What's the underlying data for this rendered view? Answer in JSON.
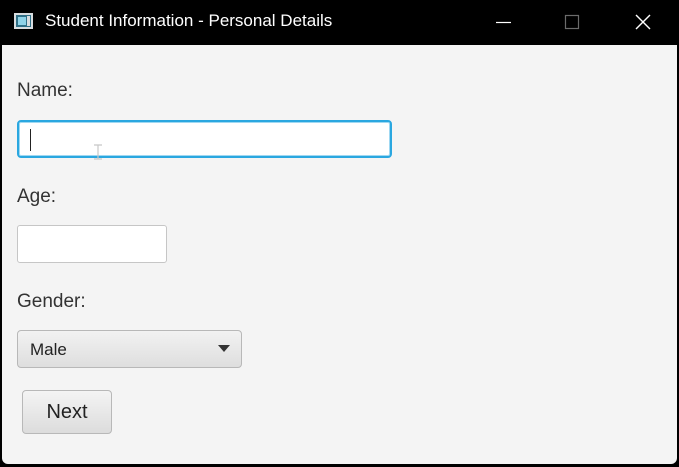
{
  "window": {
    "title": "Student Information - Personal Details",
    "app_icon": "java-app-icon",
    "controls": {
      "minimize_icon": "minimize-icon",
      "maximize_icon": "maximize-icon",
      "close_icon": "close-icon"
    }
  },
  "form": {
    "name": {
      "label": "Name:",
      "value": ""
    },
    "age": {
      "label": "Age:",
      "value": ""
    },
    "gender": {
      "label": "Gender:",
      "selected": "Male"
    },
    "next_button": "Next"
  },
  "colors": {
    "focus_border": "#2aa7e0",
    "content_background": "#f4f4f4",
    "titlebar_background": "#000000"
  }
}
